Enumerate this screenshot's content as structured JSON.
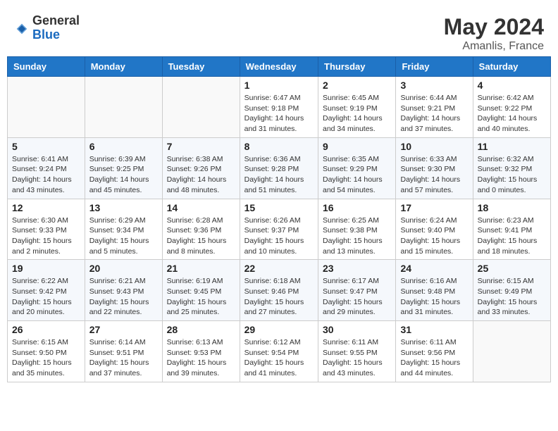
{
  "header": {
    "logo_general": "General",
    "logo_blue": "Blue",
    "month": "May 2024",
    "location": "Amanlis, France"
  },
  "calendar": {
    "weekdays": [
      "Sunday",
      "Monday",
      "Tuesday",
      "Wednesday",
      "Thursday",
      "Friday",
      "Saturday"
    ],
    "weeks": [
      [
        {
          "day": "",
          "info": ""
        },
        {
          "day": "",
          "info": ""
        },
        {
          "day": "",
          "info": ""
        },
        {
          "day": "1",
          "info": "Sunrise: 6:47 AM\nSunset: 9:18 PM\nDaylight: 14 hours\nand 31 minutes."
        },
        {
          "day": "2",
          "info": "Sunrise: 6:45 AM\nSunset: 9:19 PM\nDaylight: 14 hours\nand 34 minutes."
        },
        {
          "day": "3",
          "info": "Sunrise: 6:44 AM\nSunset: 9:21 PM\nDaylight: 14 hours\nand 37 minutes."
        },
        {
          "day": "4",
          "info": "Sunrise: 6:42 AM\nSunset: 9:22 PM\nDaylight: 14 hours\nand 40 minutes."
        }
      ],
      [
        {
          "day": "5",
          "info": "Sunrise: 6:41 AM\nSunset: 9:24 PM\nDaylight: 14 hours\nand 43 minutes."
        },
        {
          "day": "6",
          "info": "Sunrise: 6:39 AM\nSunset: 9:25 PM\nDaylight: 14 hours\nand 45 minutes."
        },
        {
          "day": "7",
          "info": "Sunrise: 6:38 AM\nSunset: 9:26 PM\nDaylight: 14 hours\nand 48 minutes."
        },
        {
          "day": "8",
          "info": "Sunrise: 6:36 AM\nSunset: 9:28 PM\nDaylight: 14 hours\nand 51 minutes."
        },
        {
          "day": "9",
          "info": "Sunrise: 6:35 AM\nSunset: 9:29 PM\nDaylight: 14 hours\nand 54 minutes."
        },
        {
          "day": "10",
          "info": "Sunrise: 6:33 AM\nSunset: 9:30 PM\nDaylight: 14 hours\nand 57 minutes."
        },
        {
          "day": "11",
          "info": "Sunrise: 6:32 AM\nSunset: 9:32 PM\nDaylight: 15 hours\nand 0 minutes."
        }
      ],
      [
        {
          "day": "12",
          "info": "Sunrise: 6:30 AM\nSunset: 9:33 PM\nDaylight: 15 hours\nand 2 minutes."
        },
        {
          "day": "13",
          "info": "Sunrise: 6:29 AM\nSunset: 9:34 PM\nDaylight: 15 hours\nand 5 minutes."
        },
        {
          "day": "14",
          "info": "Sunrise: 6:28 AM\nSunset: 9:36 PM\nDaylight: 15 hours\nand 8 minutes."
        },
        {
          "day": "15",
          "info": "Sunrise: 6:26 AM\nSunset: 9:37 PM\nDaylight: 15 hours\nand 10 minutes."
        },
        {
          "day": "16",
          "info": "Sunrise: 6:25 AM\nSunset: 9:38 PM\nDaylight: 15 hours\nand 13 minutes."
        },
        {
          "day": "17",
          "info": "Sunrise: 6:24 AM\nSunset: 9:40 PM\nDaylight: 15 hours\nand 15 minutes."
        },
        {
          "day": "18",
          "info": "Sunrise: 6:23 AM\nSunset: 9:41 PM\nDaylight: 15 hours\nand 18 minutes."
        }
      ],
      [
        {
          "day": "19",
          "info": "Sunrise: 6:22 AM\nSunset: 9:42 PM\nDaylight: 15 hours\nand 20 minutes."
        },
        {
          "day": "20",
          "info": "Sunrise: 6:21 AM\nSunset: 9:43 PM\nDaylight: 15 hours\nand 22 minutes."
        },
        {
          "day": "21",
          "info": "Sunrise: 6:19 AM\nSunset: 9:45 PM\nDaylight: 15 hours\nand 25 minutes."
        },
        {
          "day": "22",
          "info": "Sunrise: 6:18 AM\nSunset: 9:46 PM\nDaylight: 15 hours\nand 27 minutes."
        },
        {
          "day": "23",
          "info": "Sunrise: 6:17 AM\nSunset: 9:47 PM\nDaylight: 15 hours\nand 29 minutes."
        },
        {
          "day": "24",
          "info": "Sunrise: 6:16 AM\nSunset: 9:48 PM\nDaylight: 15 hours\nand 31 minutes."
        },
        {
          "day": "25",
          "info": "Sunrise: 6:15 AM\nSunset: 9:49 PM\nDaylight: 15 hours\nand 33 minutes."
        }
      ],
      [
        {
          "day": "26",
          "info": "Sunrise: 6:15 AM\nSunset: 9:50 PM\nDaylight: 15 hours\nand 35 minutes."
        },
        {
          "day": "27",
          "info": "Sunrise: 6:14 AM\nSunset: 9:51 PM\nDaylight: 15 hours\nand 37 minutes."
        },
        {
          "day": "28",
          "info": "Sunrise: 6:13 AM\nSunset: 9:53 PM\nDaylight: 15 hours\nand 39 minutes."
        },
        {
          "day": "29",
          "info": "Sunrise: 6:12 AM\nSunset: 9:54 PM\nDaylight: 15 hours\nand 41 minutes."
        },
        {
          "day": "30",
          "info": "Sunrise: 6:11 AM\nSunset: 9:55 PM\nDaylight: 15 hours\nand 43 minutes."
        },
        {
          "day": "31",
          "info": "Sunrise: 6:11 AM\nSunset: 9:56 PM\nDaylight: 15 hours\nand 44 minutes."
        },
        {
          "day": "",
          "info": ""
        }
      ]
    ]
  }
}
